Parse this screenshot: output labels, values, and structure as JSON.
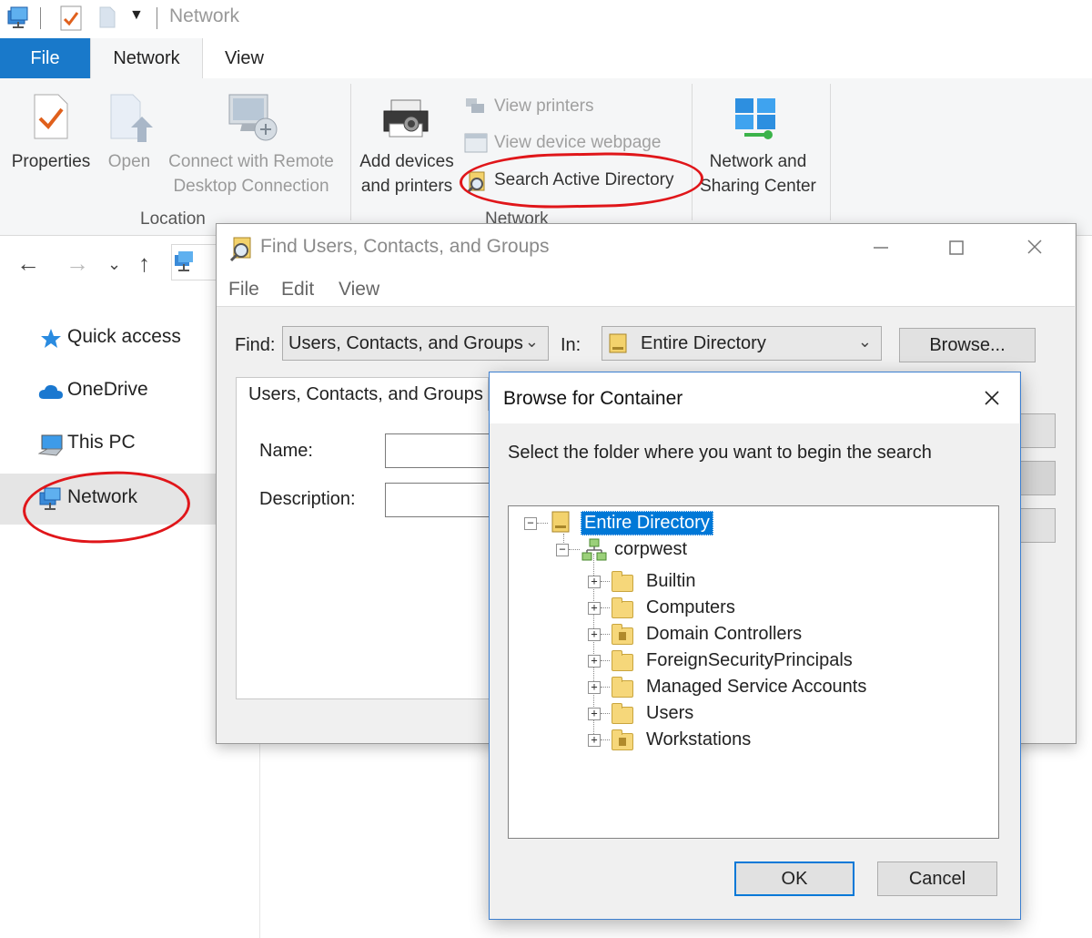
{
  "window": {
    "title": "Network"
  },
  "ribbon": {
    "tabs": [
      {
        "label": "File"
      },
      {
        "label": "Network"
      },
      {
        "label": "View"
      }
    ],
    "location_group": {
      "label": "Location",
      "properties": "Properties",
      "open": "Open",
      "connect_line1": "Connect with Remote",
      "connect_line2": "Desktop Connection"
    },
    "network_group": {
      "label": "Network",
      "add_devices_line1": "Add devices",
      "add_devices_line2": "and printers",
      "view_printers": "View printers",
      "view_device_webpage": "View device webpage",
      "search_ad": "Search Active Directory"
    },
    "sharing_center_line1": "Network and",
    "sharing_center_line2": "Sharing Center"
  },
  "nav": {
    "items": [
      {
        "label": "Quick access"
      },
      {
        "label": "OneDrive"
      },
      {
        "label": "This PC"
      },
      {
        "label": "Network"
      }
    ]
  },
  "find_dialog": {
    "title": "Find Users, Contacts, and Groups",
    "menu": [
      "File",
      "Edit",
      "View"
    ],
    "find_label": "Find:",
    "find_value": "Users, Contacts, and Groups",
    "in_label": "In:",
    "in_value": "Entire Directory",
    "browse_label": "Browse...",
    "tab_label": "Users, Contacts, and Groups",
    "name_label": "Name:",
    "description_label": "Description:"
  },
  "browse_dialog": {
    "title": "Browse for Container",
    "prompt": "Select the folder where you want to begin the search",
    "root": "Entire Directory",
    "domain": "corpwest",
    "children": [
      {
        "label": "Builtin",
        "ou": false
      },
      {
        "label": "Computers",
        "ou": false
      },
      {
        "label": "Domain Controllers",
        "ou": true
      },
      {
        "label": "ForeignSecurityPrincipals",
        "ou": false
      },
      {
        "label": "Managed Service Accounts",
        "ou": false
      },
      {
        "label": "Users",
        "ou": false
      },
      {
        "label": "Workstations",
        "ou": true
      }
    ],
    "ok_label": "OK",
    "cancel_label": "Cancel"
  },
  "colors": {
    "accent": "#1979ca",
    "selection": "#0078d7",
    "annotation": "#e0161a"
  }
}
